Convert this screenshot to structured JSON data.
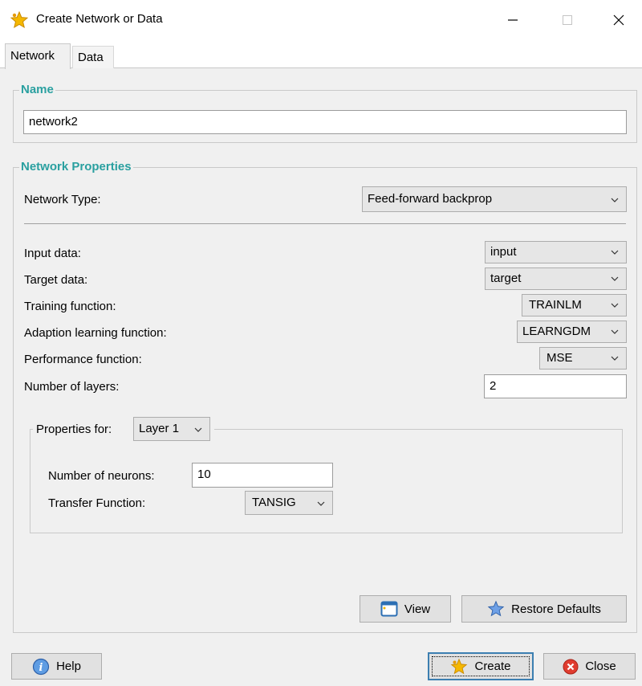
{
  "window": {
    "title": "Create Network or Data",
    "icon": "star-icon",
    "controls": [
      "minimize",
      "maximize",
      "close"
    ]
  },
  "tabs": [
    {
      "label": "Network",
      "selected": true
    },
    {
      "label": "Data",
      "selected": false
    }
  ],
  "name_group": {
    "legend": "Name",
    "value": "network2"
  },
  "properties_group": {
    "legend": "Network Properties",
    "network_type_label": "Network Type:",
    "network_type_value": "Feed-forward backprop",
    "input_data_label": "Input data:",
    "input_data_value": "input",
    "target_data_label": "Target data:",
    "target_data_value": "target",
    "training_function_label": "Training function:",
    "training_function_value": "TRAINLM",
    "adaption_function_label": "Adaption learning function:",
    "adaption_function_value": "LEARNGDM",
    "performance_function_label": "Performance function:",
    "performance_function_value": "MSE",
    "num_layers_label": "Number of layers:",
    "num_layers_value": "2"
  },
  "layer_group": {
    "properties_for_label": "Properties for:",
    "layer_value": "Layer 1",
    "num_neurons_label": "Number of neurons:",
    "num_neurons_value": "10",
    "transfer_function_label": "Transfer Function:",
    "transfer_function_value": "TANSIG"
  },
  "buttons": {
    "view": "View",
    "restore_defaults": "Restore Defaults",
    "help": "Help",
    "create": "Create",
    "close": "Close"
  },
  "colors": {
    "legend": "#2aa0a0",
    "default_button_border": "#3c7fb1"
  }
}
